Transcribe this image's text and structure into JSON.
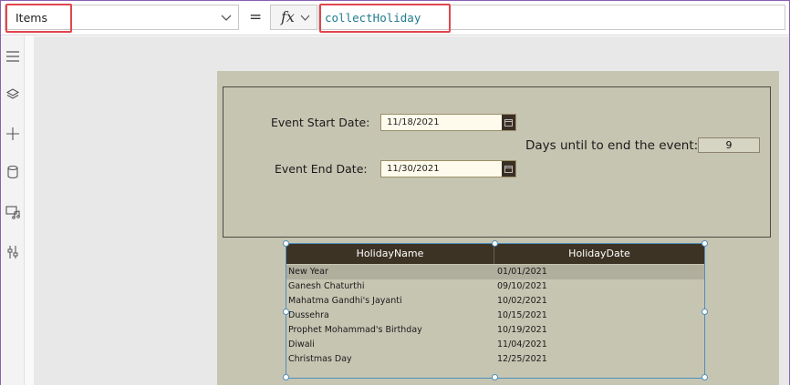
{
  "formula_bar": {
    "property": "Items",
    "equals": "=",
    "fx_label": "fx",
    "formula": "collectHoliday"
  },
  "left_rail": {
    "icons": [
      "hamburger-menu-icon",
      "layers-icon",
      "plus-icon",
      "database-icon",
      "media-icon",
      "tools-icon"
    ]
  },
  "form": {
    "start_label": "Event Start Date:",
    "start_value": "11/18/2021",
    "end_label": "Event End Date:",
    "end_value": "11/30/2021",
    "days_label": "Days until to end the event:",
    "days_value": "9"
  },
  "gallery": {
    "headers": [
      "HolidayName",
      "HolidayDate"
    ],
    "rows": [
      {
        "name": "New Year",
        "date": "01/01/2021"
      },
      {
        "name": "Ganesh Chaturthi",
        "date": "09/10/2021"
      },
      {
        "name": "Mahatma Gandhi's Jayanti",
        "date": "10/02/2021"
      },
      {
        "name": "Dussehra",
        "date": "10/15/2021"
      },
      {
        "name": "Prophet Mohammad's Birthday",
        "date": "10/19/2021"
      },
      {
        "name": "Diwali",
        "date": "11/04/2021"
      },
      {
        "name": "Christmas Day",
        "date": "12/25/2021"
      }
    ]
  },
  "colors": {
    "accent_highlight": "#e0474c",
    "formula_text": "#1f7a8c",
    "screen_bg": "#c6c5b2",
    "header_bg": "#3d3325",
    "selection": "#4f8fbd"
  }
}
